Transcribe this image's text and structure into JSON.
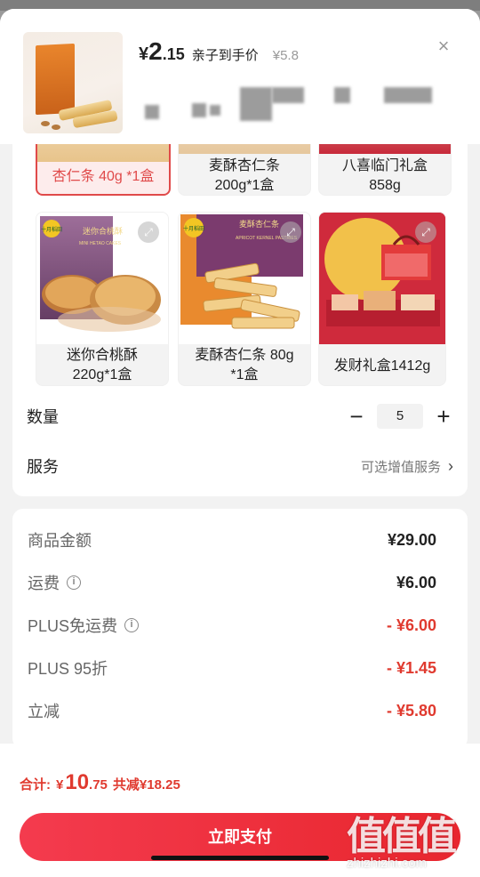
{
  "header": {
    "currency": "¥",
    "price_int": "2",
    "price_dec": ".15",
    "price_label": "亲子到手价",
    "original_price": "¥5.8",
    "close_glyph": "×"
  },
  "options": [
    {
      "label": "杏仁条 40g *1盒",
      "selected": true
    },
    {
      "label": "麦酥杏仁条 200g*1盒",
      "selected": false
    },
    {
      "label": "八喜临门礼盒 858g",
      "selected": false
    },
    {
      "label": "迷你合桃酥 220g*1盒",
      "selected": false
    },
    {
      "label": "麦酥杏仁条 80g *1盒",
      "selected": false
    },
    {
      "label": "发财礼盒1412g",
      "selected": false
    }
  ],
  "option_lines": {
    "o1a": "杏仁条 40g *1盒",
    "o2a": "麦酥杏仁条",
    "o2b": "200g*1盒",
    "o3a": "八喜临门礼盒",
    "o3b": "858g",
    "o4a": "迷你合桃酥",
    "o4b": "220g*1盒",
    "o5a": "麦酥杏仁条 80g",
    "o5b": "*1盒",
    "o6a": "发财礼盒1412g"
  },
  "package_text": {
    "mini_brand": "十月稻田",
    "mini_cn": "迷你合桃酥",
    "mini_en": "MINI HETAO CAKES",
    "apricot_brand": "十月稻田",
    "apricot_cn": "麦酥杏仁条",
    "apricot_en": "APRICOT KERNEL PASTRIES"
  },
  "quantity": {
    "label": "数量",
    "value": "5",
    "minus": "−",
    "plus": "+"
  },
  "service": {
    "label": "服务",
    "hint": "可选增值服务",
    "chevron": "›"
  },
  "summary": [
    {
      "label": "商品金额",
      "value": "¥29.00",
      "red": false,
      "info": false
    },
    {
      "label": "运费",
      "value": "¥6.00",
      "red": false,
      "info": true
    },
    {
      "label": "PLUS免运费",
      "value": "- ¥6.00",
      "red": true,
      "info": true
    },
    {
      "label": "PLUS 95折",
      "value": "- ¥1.45",
      "red": true,
      "info": false
    },
    {
      "label": "立减",
      "value": "- ¥5.80",
      "red": true,
      "info": false
    }
  ],
  "footer": {
    "total_label": "合计:",
    "currency": "¥",
    "total_int": "10",
    "total_dec": ".75",
    "saved": "共减¥18.25",
    "pay_button": "立即支付"
  },
  "watermark": {
    "big": "值值值",
    "small": "zhizhizhi.com"
  },
  "colors": {
    "accent": "#e03a2f",
    "button": "#ee2f3a"
  }
}
